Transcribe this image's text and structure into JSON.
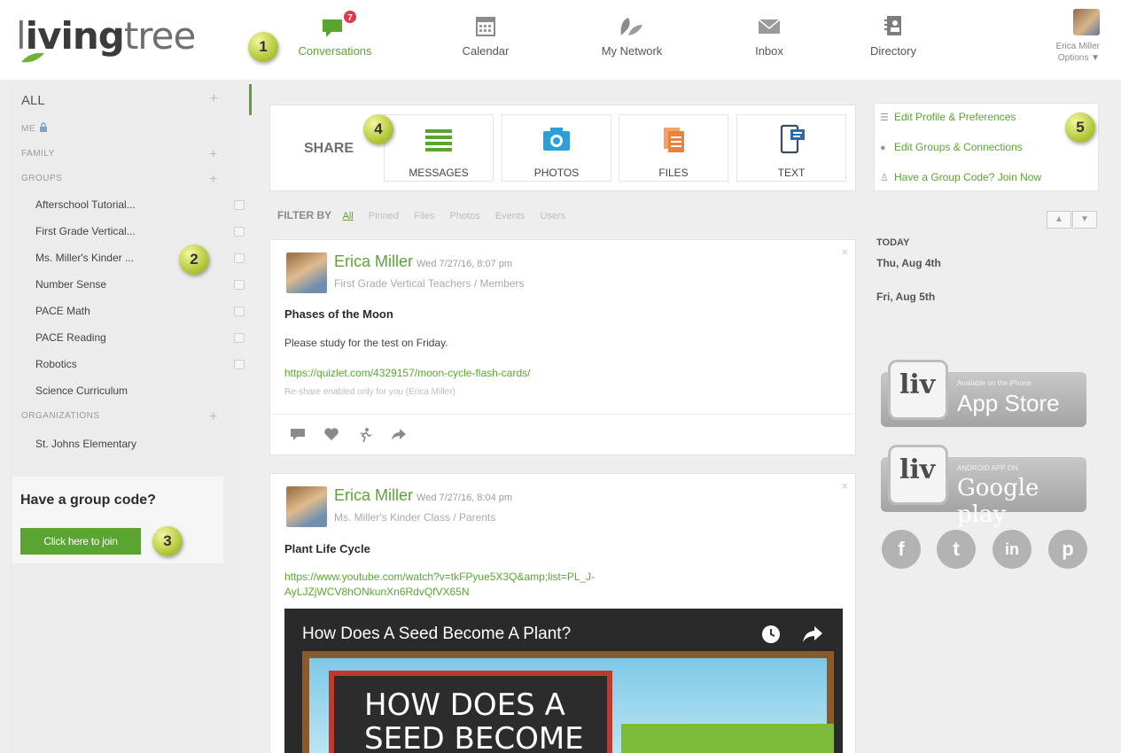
{
  "brand": {
    "logo_text_1": "l",
    "logo_text_2": "iving",
    "logo_text_3": "tree"
  },
  "nav": {
    "items": [
      {
        "label": "Conversations",
        "icon": "chat-icon",
        "active": true,
        "badge": "7"
      },
      {
        "label": "Calendar",
        "icon": "calendar-icon"
      },
      {
        "label": "My Network",
        "icon": "leaf-icon"
      },
      {
        "label": "Inbox",
        "icon": "envelope-icon"
      },
      {
        "label": "Directory",
        "icon": "address-book-icon"
      }
    ],
    "user_name": "Erica Miller",
    "user_options": "Options ▼"
  },
  "steps": [
    "1",
    "2",
    "3",
    "4",
    "5"
  ],
  "sidebar": {
    "all_label": "ALL",
    "me_label": "ME",
    "family_label": "FAMILY",
    "groups_label": "GROUPS",
    "groups": [
      "Afterschool Tutorial...",
      "First Grade Vertical...",
      "Ms. Miller's Kinder ...",
      "Number Sense",
      "PACE Math",
      "PACE Reading",
      "Robotics",
      "Science Curriculum"
    ],
    "organizations_label": "ORGANIZATIONS",
    "organizations": [
      "St. Johns Elementary"
    ],
    "plus": "+"
  },
  "group_code": {
    "title": "Have a group code?",
    "button": "Click here to join"
  },
  "share": {
    "label": "SHARE",
    "tiles": [
      {
        "label": "MESSAGES",
        "icon": "lines-icon"
      },
      {
        "label": "PHOTOS",
        "icon": "camera-icon"
      },
      {
        "label": "FILES",
        "icon": "files-icon"
      },
      {
        "label": "TEXT",
        "icon": "phone-text-icon"
      }
    ]
  },
  "filter": {
    "label": "FILTER BY",
    "options": [
      "All",
      "Pinned",
      "Files",
      "Photos",
      "Events",
      "Users"
    ]
  },
  "posts": [
    {
      "author": "Erica Miller",
      "date": "Wed 7/27/16, 8:07 pm",
      "group": "First Grade Vertical Teachers  /  Members",
      "title": "Phases of the Moon",
      "body": "Please study for the test on Friday.",
      "link": "https://quizlet.com/4329157/moon-cycle-flash-cards/",
      "note": "Re-share enabled only for you (Erica Miller)",
      "close": "×"
    },
    {
      "author": "Erica Miller",
      "date": "Wed 7/27/16, 8:04 pm",
      "group": "Ms. Miller's Kinder Class  /  Parents",
      "title": "Plant Life Cycle",
      "link": "https://www.youtube.com/watch?v=tkFPyue5X3Q&amp;list=PL_J-AyLJZjWCV8hONkunXn6RdvQfVX65N",
      "video_title": "How Does A Seed Become A Plant?",
      "video_board": "HOW DOES A SEED BECOME",
      "close": "×"
    }
  ],
  "right": {
    "links": [
      {
        "label": "Edit Profile & Preferences",
        "icon": "sliders-icon"
      },
      {
        "label": "Edit Groups & Connections",
        "icon": "groups-icon"
      },
      {
        "label": "Have a Group Code? Join Now",
        "icon": "people-icon"
      }
    ],
    "up": "▲",
    "down": "▼",
    "today_label": "TODAY",
    "days": [
      "Thu, Aug 4th",
      "Fri, Aug 5th"
    ],
    "app_store": {
      "logo": "liv",
      "small": "Available on the iPhone",
      "big": "App Store"
    },
    "google_play": {
      "logo": "liv",
      "small": "ANDROID APP ON",
      "big": "Google play"
    },
    "social": [
      "f",
      "t",
      "in",
      "p"
    ]
  },
  "colors": {
    "accent": "#5aa532",
    "badge": "#e2384b",
    "step": "#b6c93c"
  }
}
